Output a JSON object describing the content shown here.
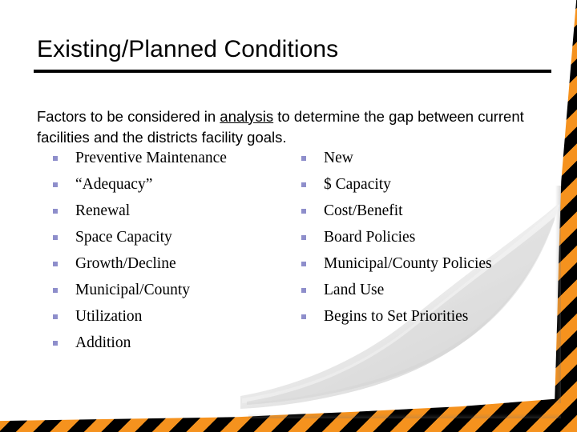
{
  "slide": {
    "title": "Existing/Planned Conditions",
    "lead_before": "Factors to be considered in ",
    "lead_underlined": "analysis",
    "lead_after": " to determine the gap between current facilities and the districts facility goals.",
    "columns": {
      "left": {
        "items": [
          "Preventive Maintenance",
          "“Adequacy”",
          "Renewal",
          "Space Capacity",
          "Growth/Decline",
          "Municipal/County",
          "Utilization",
          "Addition"
        ]
      },
      "right": {
        "items": [
          "New",
          "$ Capacity",
          "Cost/Benefit",
          "Board Policies",
          "Municipal/County Policies",
          "Land Use",
          "Begins to Set Priorities"
        ]
      }
    }
  },
  "theme": {
    "background": "#ffffff",
    "text_color": "#000000",
    "bullet_marker_color": "#8e8ecb",
    "rule_color": "#000000",
    "accent_stripe_orange": "#f5921e",
    "accent_stripe_black": "#000000",
    "curl_shadow": "#d9d9d9"
  },
  "decoration": {
    "corner_style": "page-curl",
    "stripe_pattern": "diagonal-hazard-stripes"
  }
}
